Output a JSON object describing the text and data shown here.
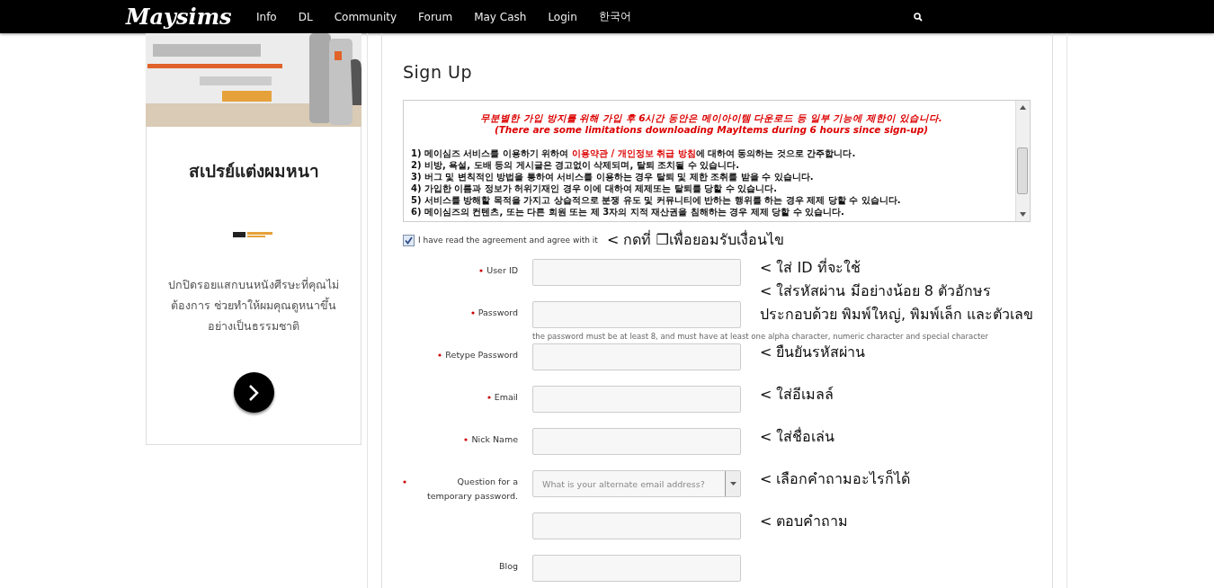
{
  "nav": {
    "logo": "Maysims",
    "items": [
      "Info",
      "DL",
      "Community",
      "Forum",
      "May Cash",
      "Login",
      "한국어"
    ]
  },
  "sidebar": {
    "heading": "สเปรย์แต่งผมหนา",
    "text": "ปกปิดรอยแสกบนหนังศีรษะที่คุณไม่ต้องการ ช่วยทำให้ผมคุณดูหนาขึ้นอย่างเป็นธรรมชาติ"
  },
  "signup": {
    "title": "Sign Up",
    "agreement": {
      "notice": [
        "무분별한 가입 방지를 위해 가입 후 6시간 동안은 메이아이템 다운로드 등 일부 기능에 제한이 있습니다.",
        "(There are some limitations downloading MayItems during 6 hours since sign-up)"
      ],
      "rules": [
        {
          "before": "1) 메이심즈 서비스를 이용하기 위하여 ",
          "link": "이용약관 / 개인정보 취급 방침",
          "after": "에 대하여 동의하는 것으로 간주합니다."
        },
        {
          "before": "2) 비방, 욕설, 도배 등의 게시글은 경고없이 삭제되며, 탈퇴 조치될 수 있습니다."
        },
        {
          "before": "3) 버그 및 변칙적인 방법을 통하여 서비스를 이용하는 경우 탈퇴 및 제한 조취를 받을 수 있습니다."
        },
        {
          "before": "4) 가입한 이름과 정보가 허위기재인 경우 이에 대하여 제제또는 탈퇴를 당할 수 있습니다."
        },
        {
          "before": "5) 서비스를 방해할 목적을 가지고 상습적으로 분쟁 유도 및 커뮤니티에 반하는 행위를 하는 경우 제제 당할 수 있습니다."
        },
        {
          "before": "6) 메이심즈의 컨텐츠, 또는 다른 회원 또는 제 3자의 지적 재산권을 침해하는 경우 제제 당할 수 있습니다."
        }
      ]
    },
    "agree": {
      "label": "I have read the agreement and agree with it",
      "checked": true,
      "annotation": "< กดที่ ❒เพื่อยอมรับเงื่อนไข"
    },
    "fields": [
      {
        "kind": "input",
        "label": "User ID",
        "required": true,
        "annotation": [
          "< ใส่ ID ที่จะใช้"
        ]
      },
      {
        "kind": "input",
        "label": "Password",
        "required": true,
        "annotation": [
          "< ใส่รหัสผ่าน มีอย่างน้อย 8 ตัวอักษร",
          "ประกอบด้วย พิมพ์ใหญ่, พิมพ์เล็ก และตัวเลข"
        ],
        "hint": "the password must be at least 8, and must have at least one alpha character, numeric character and special character"
      },
      {
        "kind": "input",
        "label": "Retype Password",
        "required": true,
        "annotation": [
          "< ยืนยันรหัสผ่าน"
        ]
      },
      {
        "kind": "input",
        "label": "Email",
        "required": true,
        "annotation": [
          "< ใส่อีเมลล์"
        ]
      },
      {
        "kind": "input",
        "label": "Nick Name",
        "required": true,
        "annotation": [
          "< ใส่ชื่อเล่น"
        ]
      },
      {
        "kind": "select",
        "label": "Question for a temporary password.",
        "required": true,
        "placeholder": "What is your alternate email address?",
        "annotation": [
          "< เลือกคำถามอะไรก็ได้"
        ]
      },
      {
        "kind": "input",
        "annotation": [
          "< ตอบคำถาม"
        ]
      },
      {
        "kind": "input",
        "label": "Blog",
        "required": false
      }
    ]
  }
}
